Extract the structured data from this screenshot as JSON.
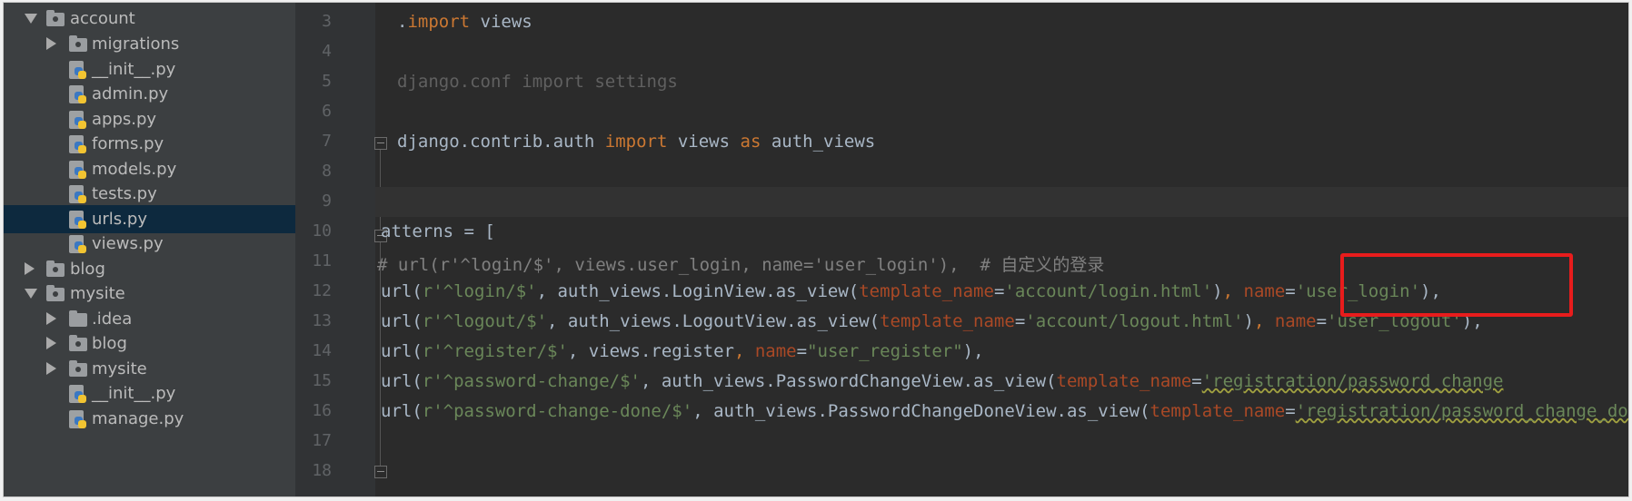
{
  "project_tree": {
    "items": [
      {
        "label": "account",
        "icon": "folder-icon",
        "expanded": true
      },
      {
        "label": "migrations",
        "icon": "folder-icon",
        "expanded": false
      },
      {
        "label": "__init__.py",
        "icon": "python-file-icon"
      },
      {
        "label": "admin.py",
        "icon": "python-file-icon"
      },
      {
        "label": "apps.py",
        "icon": "python-file-icon"
      },
      {
        "label": "forms.py",
        "icon": "python-file-icon"
      },
      {
        "label": "models.py",
        "icon": "python-file-icon"
      },
      {
        "label": "tests.py",
        "icon": "python-file-icon"
      },
      {
        "label": "urls.py",
        "icon": "python-file-icon",
        "selected": true
      },
      {
        "label": "views.py",
        "icon": "python-file-icon"
      },
      {
        "label": "blog",
        "icon": "folder-icon",
        "expanded": false
      },
      {
        "label": "mysite",
        "icon": "folder-icon",
        "expanded": true
      },
      {
        "label": ".idea",
        "icon": "folder-icon",
        "expanded": false
      },
      {
        "label": "blog",
        "icon": "folder-icon",
        "expanded": false
      },
      {
        "label": "mysite",
        "icon": "folder-icon",
        "expanded": false
      },
      {
        "label": "__init__.py",
        "icon": "python-file-icon"
      },
      {
        "label": "manage.py",
        "icon": "python-file-icon"
      }
    ]
  },
  "editor": {
    "current_line": "9",
    "line_numbers": [
      "3",
      "4",
      "5",
      "6",
      "7",
      "8",
      "9",
      "10",
      "11",
      "12",
      "13",
      "14",
      "15",
      "16",
      "17",
      "18"
    ],
    "lines": {
      "l3": [
        ".",
        "import",
        " views"
      ],
      "l5": [
        "django.conf import settings"
      ],
      "l7": [
        "django.contrib.auth ",
        "import",
        " views ",
        "as",
        " auth_views"
      ],
      "l10": [
        "atterns = ["
      ],
      "l11": [
        "# url(r'^login/$', views.user_login, name='user_login'),  # 自定义的登录"
      ],
      "l12": [
        "url(",
        "r'^login/$'",
        ", auth_views.LoginView.as_view(",
        "template_name",
        "=",
        "'account/login.html'",
        ")",
        ", ",
        "name",
        "=",
        "'user_login'",
        "),"
      ],
      "l13": [
        "url(",
        "r'^logout/$'",
        ", auth_views.LogoutView.as_view(",
        "template_name",
        "=",
        "'account/logout.html'",
        ")",
        ", ",
        "name",
        "=",
        "'user_logout'",
        "),"
      ],
      "l14": [
        "url(",
        "r'^register/$'",
        ", views.register",
        ", ",
        "name",
        "=",
        "\"user_register\"",
        "),"
      ],
      "l15": [
        "url(",
        "r'^password-change/$'",
        ", auth_views.PasswordChangeView.as_view(",
        "template_name",
        "=",
        "'registration/password_change"
      ],
      "l16": [
        "url(",
        "r'^password-change-done/$'",
        ", auth_views.PasswordChangeDoneView.as_view(",
        "template_name",
        "=",
        "'registration/password_change_done"
      ]
    }
  },
  "colors": {
    "keyword": "#cc7832",
    "string": "#6a8759",
    "parameter": "#aa4926",
    "comment": "#808080",
    "default_text": "#a9b7c6",
    "highlight_box": "#e81c1c"
  }
}
